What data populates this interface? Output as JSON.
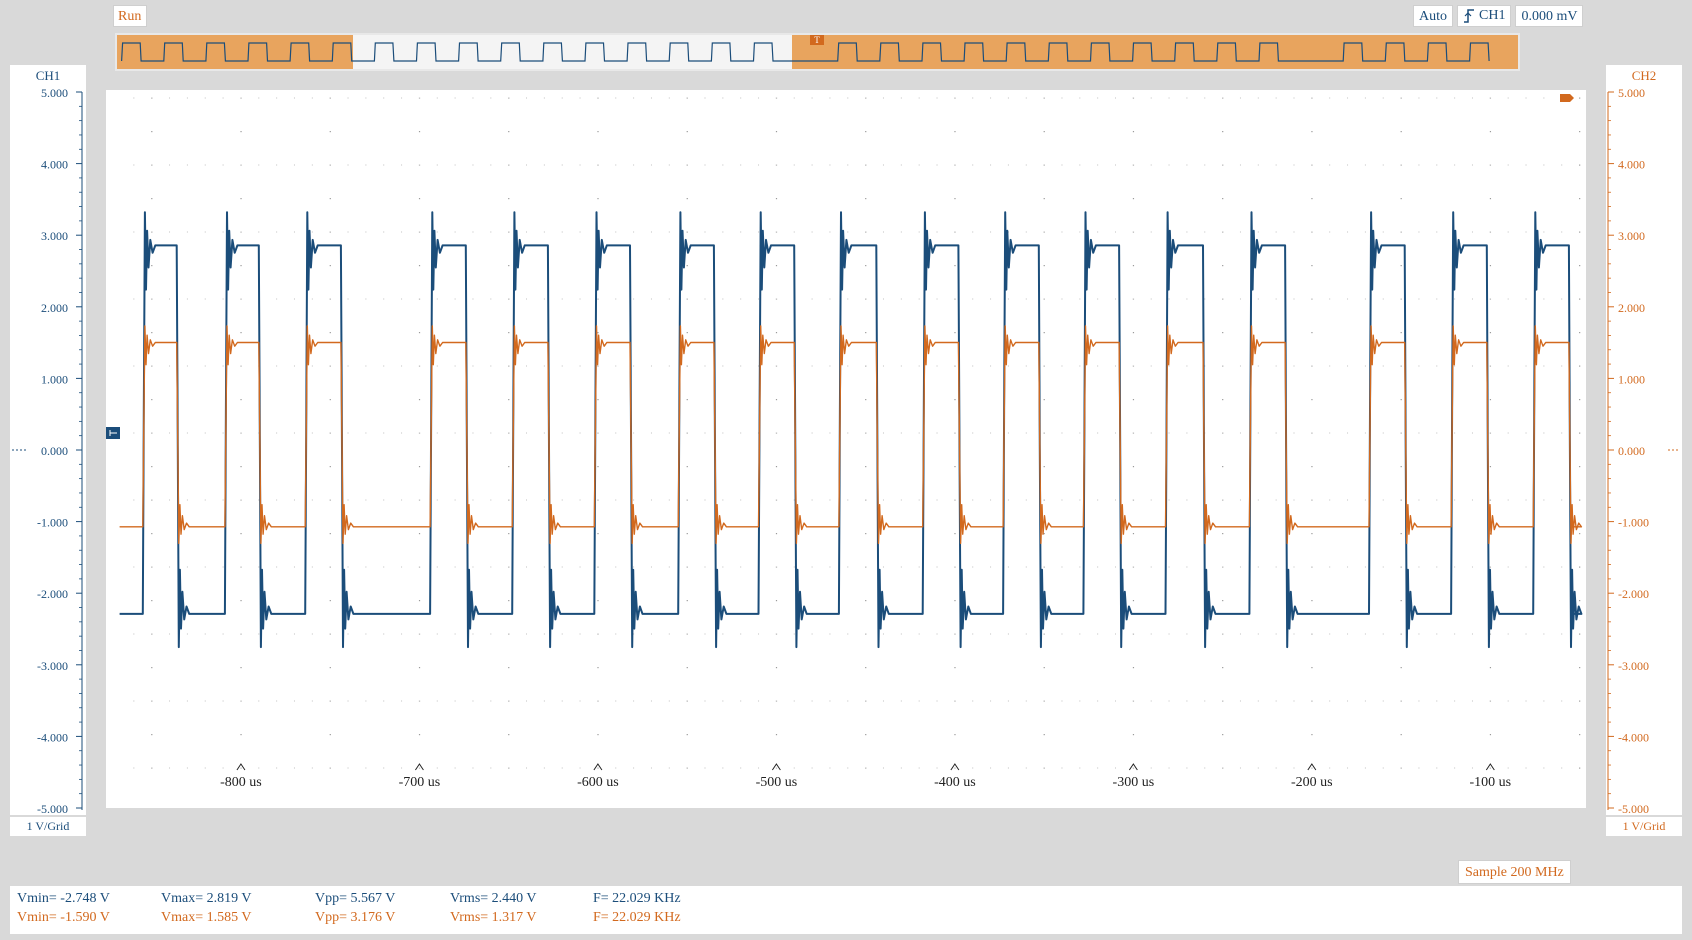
{
  "toolbar": {
    "run_label": "Run",
    "trigger_mode": "Auto",
    "trigger_channel": "CH1",
    "trigger_level": "0.000 mV",
    "trigger_edge_icon": "rising-edge-icon"
  },
  "channels": {
    "ch1": {
      "label": "CH1",
      "scale": "1 V/Grid",
      "color": "#1b4d7a"
    },
    "ch2": {
      "label": "CH2",
      "scale": "1 V/Grid",
      "color": "#d2691e"
    }
  },
  "sample_rate": "Sample 200 MHz",
  "chart_data": {
    "type": "line",
    "y_tick_labels": [
      "5.000",
      "4.000",
      "3.000",
      "2.000",
      "1.000",
      "0.000",
      "-1.000",
      "-2.000",
      "-3.000",
      "-4.000",
      "-5.000"
    ],
    "x_tick_labels": [
      "-800 us",
      "-700 us",
      "-600 us",
      "-500 us",
      "-400 us",
      "-300 us",
      "-200 us",
      "-100 us"
    ],
    "x_unit": "us",
    "xlim": [
      -870,
      -52
    ],
    "ylim": [
      -5,
      5
    ],
    "grid": true,
    "series": [
      {
        "channel": "CH1",
        "color": "#1b4d7a",
        "high": 2.8,
        "low": -2.7,
        "pulses_high": [
          [
            -855,
            -836
          ],
          [
            -809,
            -790
          ],
          [
            -764,
            -744
          ],
          [
            -694,
            -674
          ],
          [
            -648,
            -628
          ],
          [
            -602,
            -582
          ],
          [
            -555,
            -535
          ],
          [
            -510,
            -490
          ],
          [
            -465,
            -444
          ],
          [
            -418,
            -398
          ],
          [
            -373,
            -353
          ],
          [
            -328,
            -308
          ],
          [
            -282,
            -261
          ],
          [
            -235,
            -215
          ],
          [
            -168,
            -148
          ],
          [
            -122,
            -102
          ],
          [
            -76,
            -56
          ]
        ]
      },
      {
        "channel": "CH2",
        "color": "#d2691e",
        "high": 1.35,
        "low": -1.4,
        "pulses_high": [
          [
            -855,
            -836
          ],
          [
            -809,
            -790
          ],
          [
            -764,
            -744
          ],
          [
            -694,
            -674
          ],
          [
            -648,
            -628
          ],
          [
            -602,
            -582
          ],
          [
            -555,
            -535
          ],
          [
            -510,
            -490
          ],
          [
            -465,
            -444
          ],
          [
            -418,
            -398
          ],
          [
            -373,
            -353
          ],
          [
            -328,
            -308
          ],
          [
            -282,
            -261
          ],
          [
            -235,
            -215
          ],
          [
            -168,
            -148
          ],
          [
            -122,
            -102
          ],
          [
            -76,
            -56
          ]
        ]
      }
    ]
  },
  "measurements": {
    "ch1": {
      "vmin": "Vmin= -2.748 V",
      "vmax": "Vmax= 2.819 V",
      "vpp": "Vpp= 5.567 V",
      "vrms": "Vrms= 2.440 V",
      "freq": "F= 22.029 KHz"
    },
    "ch2": {
      "vmin": "Vmin= -1.590 V",
      "vmax": "Vmax= 1.585 V",
      "vpp": "Vpp= 3.176 V",
      "vrms": "Vrms= 1.317 V",
      "freq": "F= 22.029 KHz"
    }
  }
}
